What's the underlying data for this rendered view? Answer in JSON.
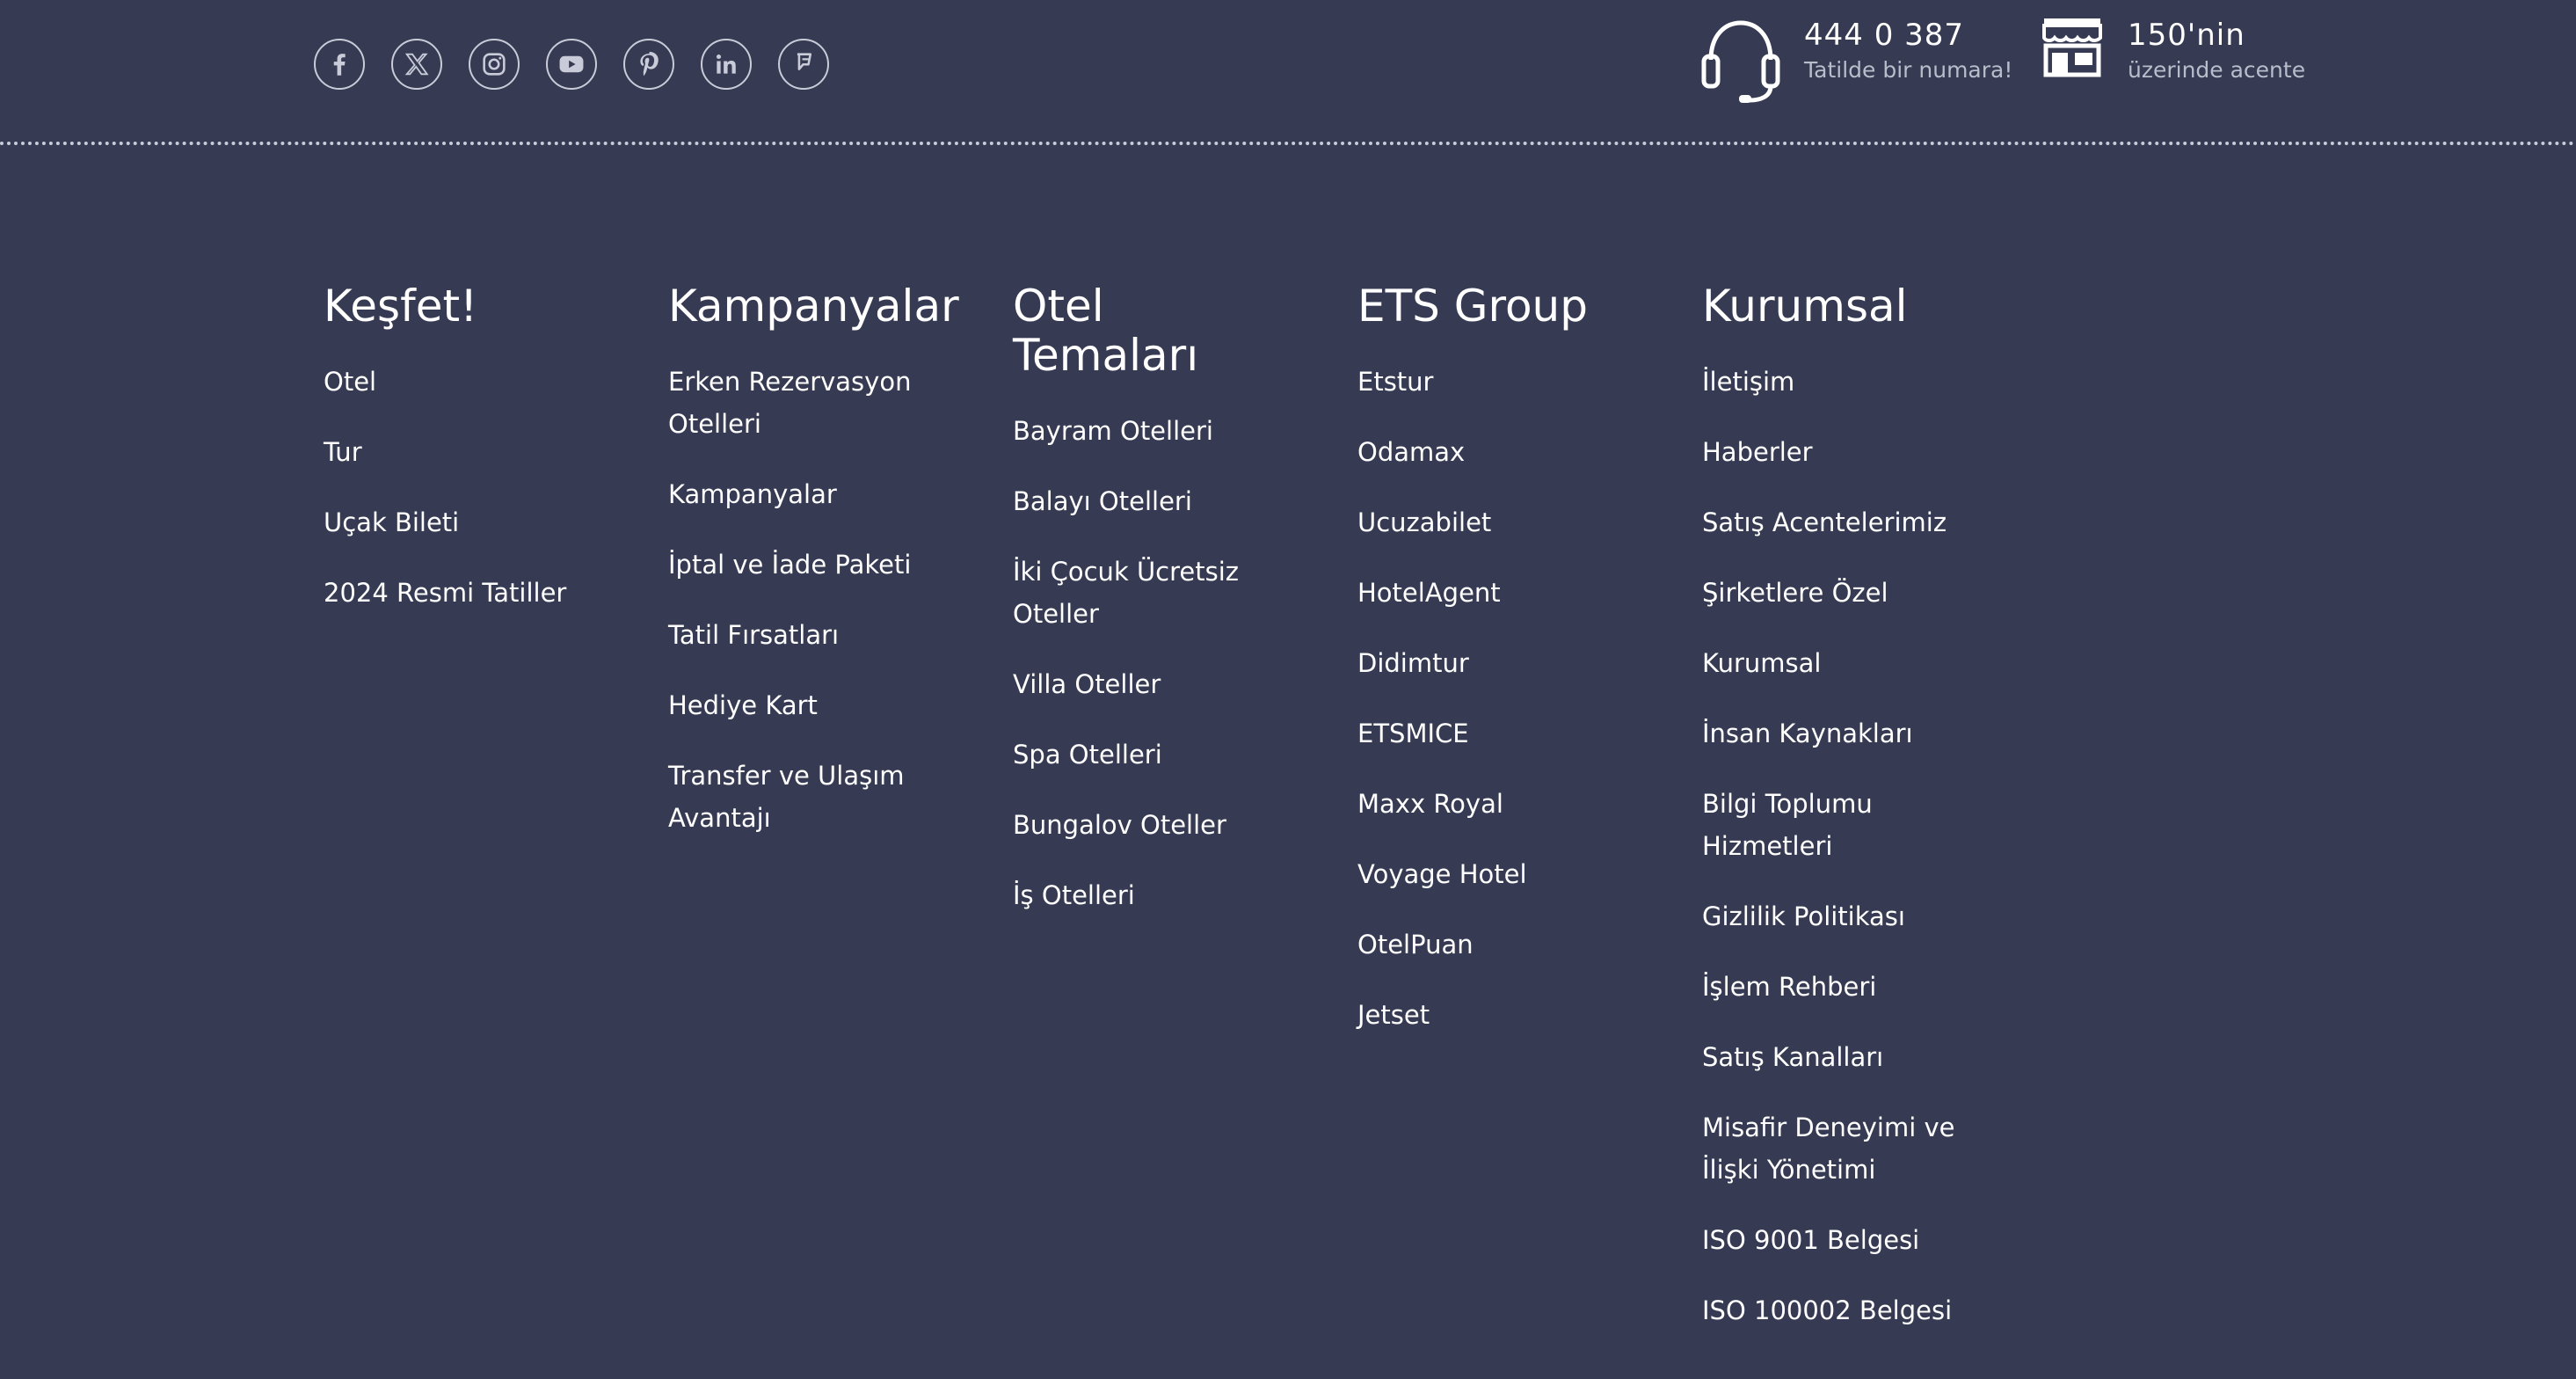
{
  "social": [
    {
      "icon": "facebook-icon"
    },
    {
      "icon": "x-icon"
    },
    {
      "icon": "instagram-icon"
    },
    {
      "icon": "youtube-icon"
    },
    {
      "icon": "pinterest-icon"
    },
    {
      "icon": "linkedin-icon"
    },
    {
      "icon": "foursquare-icon"
    }
  ],
  "contact": {
    "phone": "444 0 387",
    "phone_sub": "Tatilde bir numara!",
    "agency": "150'nin",
    "agency_sub": "üzerinde acente"
  },
  "columns": [
    {
      "title": "Keşfet!",
      "links": [
        "Otel",
        "Tur",
        "Uçak Bileti",
        "2024 Resmi Tatiller"
      ]
    },
    {
      "title": "Kampanyalar",
      "links": [
        "Erken Rezervasyon Otelleri",
        "Kampanyalar",
        "İptal ve İade Paketi",
        "Tatil Fırsatları",
        "Hediye Kart",
        "Transfer ve Ulaşım Avantajı"
      ]
    },
    {
      "title": "Otel Temaları",
      "links": [
        "Bayram Otelleri",
        "Balayı Otelleri",
        "İki Çocuk Ücretsiz Oteller",
        "Villa Oteller",
        "Spa Otelleri",
        "Bungalov Oteller",
        "İş Otelleri"
      ]
    },
    {
      "title": "ETS Group",
      "links": [
        "Etstur",
        "Odamax",
        "Ucuzabilet",
        "HotelAgent",
        "Didimtur",
        "ETSMICE",
        "Maxx Royal",
        "Voyage Hotel",
        "OtelPuan",
        "Jetset"
      ]
    },
    {
      "title": "Kurumsal",
      "links": [
        "İletişim",
        "Haberler",
        "Satış Acentelerimiz",
        "Şirketlere Özel",
        "Kurumsal",
        "İnsan Kaynakları",
        "Bilgi Toplumu Hizmetleri",
        "Gizlilik Politikası",
        "İşlem Rehberi",
        "Satış Kanalları",
        "Misafir Deneyimi ve İlişki Yönetimi",
        "ISO 9001 Belgesi",
        "ISO 100002 Belgesi"
      ]
    }
  ]
}
